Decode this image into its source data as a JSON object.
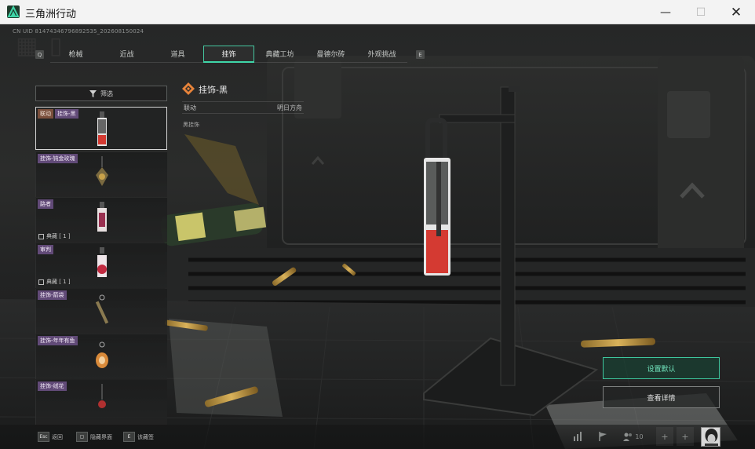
{
  "window": {
    "title": "三角洲行动",
    "minimize_glyph": "—",
    "maximize_glyph": "☐",
    "close_glyph": "✕"
  },
  "overlay": {
    "uid_text": "CN UID 81474346796892535_202608150024",
    "tab_key_left": "Q",
    "tab_key_right": "E"
  },
  "tabs": [
    {
      "label": "枪械",
      "active": false
    },
    {
      "label": "近战",
      "active": false
    },
    {
      "label": "道具",
      "active": false
    },
    {
      "label": "挂饰",
      "active": true
    },
    {
      "label": "典藏工坊",
      "active": false
    },
    {
      "label": "曼德尔砖",
      "active": false
    },
    {
      "label": "外观挑战",
      "active": false
    }
  ],
  "filter": {
    "label": "筛选",
    "icon": "filter-icon"
  },
  "items": [
    {
      "tag": "联动",
      "name": "挂饰-黑",
      "meta": "",
      "selected": true
    },
    {
      "tag": "",
      "name": "挂饰-钝金玫瑰",
      "meta": "",
      "selected": false
    },
    {
      "tag": "",
      "name": "路者",
      "meta": "典藏 [ 1 ]",
      "selected": false
    },
    {
      "tag": "",
      "name": "审判",
      "meta": "典藏 [ 1 ]",
      "selected": false
    },
    {
      "tag": "",
      "name": "挂饰-箭袋",
      "meta": "",
      "selected": false
    },
    {
      "tag": "",
      "name": "挂饰-年年有鱼",
      "meta": "",
      "selected": false
    },
    {
      "tag": "",
      "name": "挂饰-绒花",
      "meta": "",
      "selected": false
    }
  ],
  "detail": {
    "title": "挂饰-黑",
    "row_label": "联动",
    "row_value": "明日方舟",
    "description": "黑挂饰"
  },
  "actions": {
    "set_default": "设置默认",
    "view_detail": "查看详情"
  },
  "bottom_hints": [
    {
      "key": "Esc",
      "label": "返回"
    },
    {
      "key": "▢",
      "label": "隐藏界面"
    },
    {
      "key": "E",
      "label": "该藏签"
    }
  ],
  "bottom_right": {
    "friends_count": "10",
    "plus_glyph": "+"
  },
  "colors": {
    "accent_green": "#3fd6a8",
    "item_tag_bg": "#7a4f3c",
    "item_name_bg": "#785a96",
    "detail_icon": "#e8843a"
  }
}
